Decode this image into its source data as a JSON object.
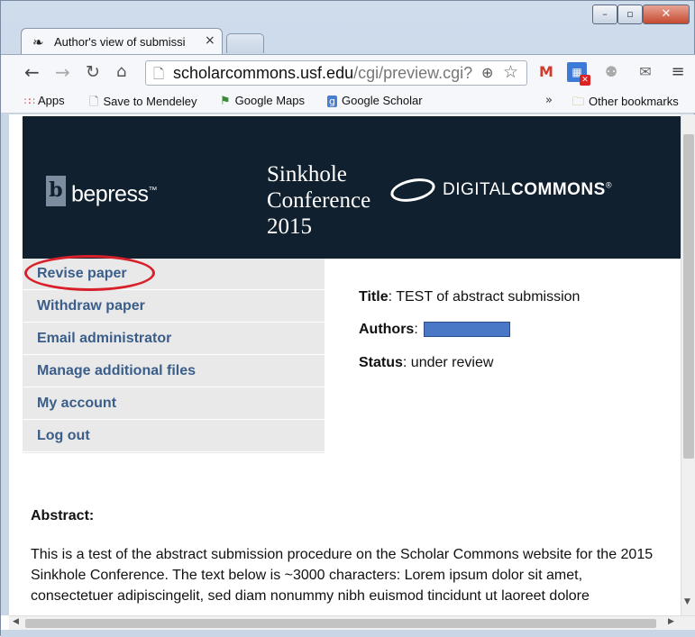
{
  "browser": {
    "tab_title": "Author's view of submissi",
    "tab_close": "×",
    "window_buttons": {
      "minimize": "–",
      "maximize": "▫",
      "close": "✕"
    },
    "url_host": "scholarcommons.usf.edu",
    "url_path": "/cgi/preview.cgi?",
    "bookmarks": [
      {
        "label": "Apps",
        "icon": "apps-grid-icon"
      },
      {
        "label": "Save to Mendeley",
        "icon": "page-icon"
      },
      {
        "label": "Google Maps",
        "icon": "maps-icon"
      },
      {
        "label": "Google Scholar",
        "icon": "scholar-icon"
      }
    ],
    "bookmarks_overflow": "»",
    "other_bookmarks": "Other bookmarks"
  },
  "banner": {
    "bepress_word": "bepress",
    "bepress_tm": "™",
    "conference_title_lines": [
      "Sinkhole",
      "Conference",
      "2015"
    ],
    "dc_light": "DIGITAL",
    "dc_bold": "COMMONS",
    "dc_tm": "®"
  },
  "menu": [
    {
      "label": "Revise paper"
    },
    {
      "label": "Withdraw paper"
    },
    {
      "label": "Email administrator"
    },
    {
      "label": "Manage additional files"
    },
    {
      "label": "My account"
    },
    {
      "label": "Log out"
    }
  ],
  "meta": {
    "title_label": "Title",
    "title_value": ": TEST of abstract submission",
    "authors_label": "Authors",
    "authors_sep": ":",
    "status_label": "Status",
    "status_value": ": under review"
  },
  "abstract": {
    "heading": "Abstract:",
    "body": "This is a test of the abstract submission procedure on the Scholar Commons website for the 2015 Sinkhole Conference. The text below is ~3000 characters: Lorem ipsum dolor sit amet, consectetuer adipiscingelit, sed diam nonummy nibh euismod tincidunt ut laoreet dolore"
  },
  "colors": {
    "banner_bg": "#10202f",
    "menu_link": "#3a5d8a",
    "menu_bg": "#e9e9e9",
    "annotation_circle": "#d8202a",
    "author_redaction": "#4a78c6"
  }
}
